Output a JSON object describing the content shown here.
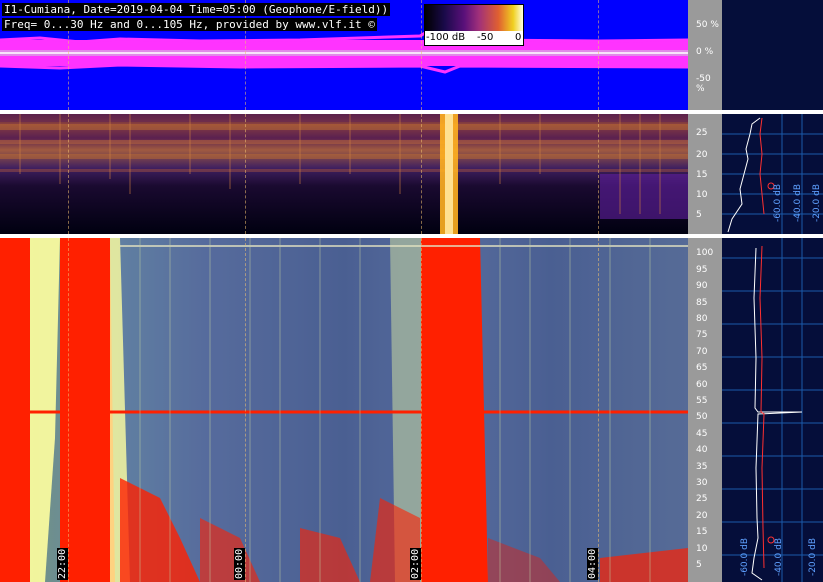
{
  "header": {
    "line1": "I1-Cumiana, Date=2019-04-04 Time=05:00 (Geophone/E-field))",
    "line2": "Freq= 0...30 Hz and 0...105 Hz, provided by www.vlf.it ©"
  },
  "colorbar": {
    "min_label": "-100 dB",
    "mid_label": "-50",
    "max_label": "0"
  },
  "waveform_scale": [
    "50 %",
    "0 %",
    "-50 %"
  ],
  "low_freq_scale": [
    "25",
    "20",
    "15",
    "10",
    "5"
  ],
  "high_freq_scale": [
    "100",
    "95",
    "90",
    "85",
    "80",
    "75",
    "70",
    "65",
    "60",
    "55",
    "50",
    "45",
    "40",
    "35",
    "30",
    "25",
    "20",
    "15",
    "10",
    "5"
  ],
  "time_labels": [
    "22:00",
    "00:00",
    "02:00",
    "04:00"
  ],
  "profile_top_db": [
    "-60.0 dB",
    "-40.0 dB",
    "-20.0 dB"
  ],
  "profile_bottom_db": [
    "-60.0 dB",
    "-40.0 dB",
    "-20.0 dB"
  ],
  "colors": {
    "waveform_bg": "#0000ff",
    "waveform_signal": "#ff33ff",
    "spectrogram_hot": "#ff2000",
    "spectrogram_cool": "#3a4a9a",
    "profile_bg": "#050e3a",
    "profile_trace": "#ffffff",
    "profile_avg": "#ff3030"
  }
}
